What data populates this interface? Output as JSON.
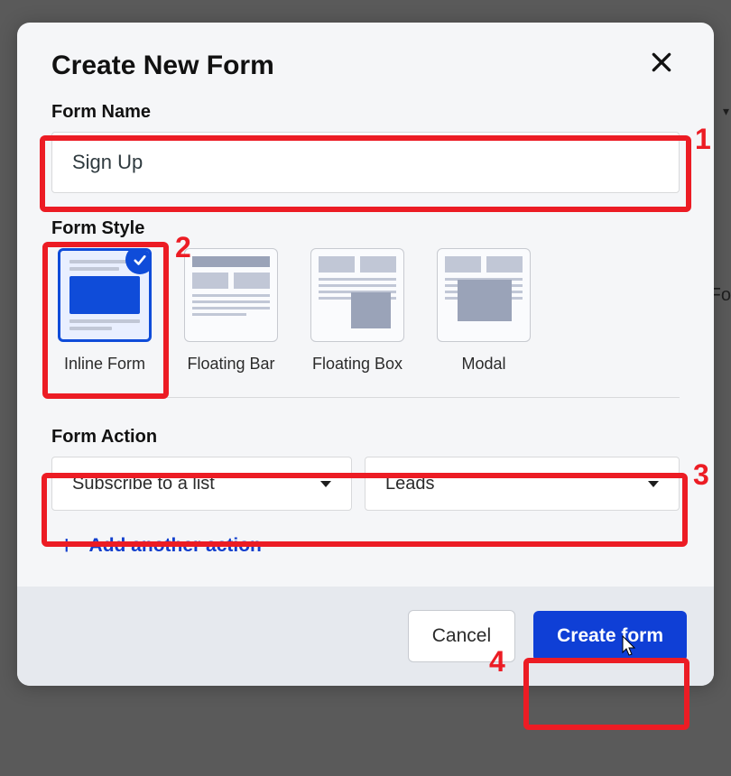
{
  "modal": {
    "title": "Create New Form",
    "formName": {
      "label": "Form Name",
      "value": "Sign Up"
    },
    "formStyle": {
      "label": "Form Style",
      "options": [
        {
          "label": "Inline Form",
          "selected": true
        },
        {
          "label": "Floating Bar",
          "selected": false
        },
        {
          "label": "Floating Box",
          "selected": false
        },
        {
          "label": "Modal",
          "selected": false
        }
      ]
    },
    "formAction": {
      "label": "Form Action",
      "action1": "Subscribe to a list",
      "action2": "Leads",
      "addAnother": "Add another action"
    },
    "footer": {
      "cancel": "Cancel",
      "create": "Create form"
    }
  },
  "annotations": {
    "one": "1",
    "two": "2",
    "three": "3",
    "four": "4"
  },
  "background": {
    "fo_fragment": "Fo"
  },
  "colors": {
    "accent": "#0f4cd9",
    "annotation": "#ec1c24"
  }
}
